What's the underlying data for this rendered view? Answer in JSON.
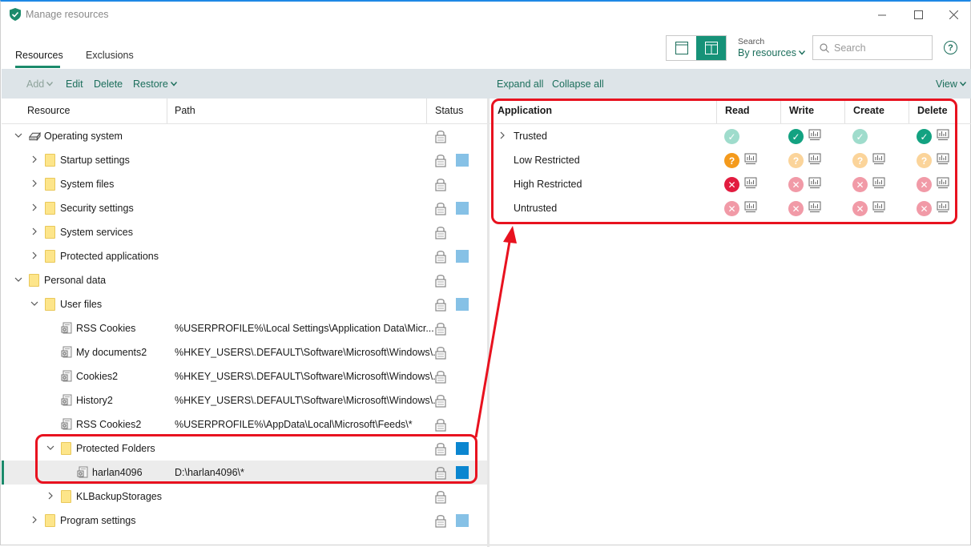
{
  "window": {
    "title": "Manage resources"
  },
  "header": {
    "tabs": [
      {
        "label": "Resources"
      },
      {
        "label": "Exclusions"
      }
    ],
    "search_caption": "Search",
    "search_mode": "By resources",
    "search_placeholder": "Search"
  },
  "toolbar": {
    "add": "Add",
    "edit": "Edit",
    "delete": "Delete",
    "restore": "Restore",
    "expand_all": "Expand all",
    "collapse_all": "Collapse all",
    "view": "View"
  },
  "left_columns": {
    "resource": "Resource",
    "path": "Path",
    "status": "Status"
  },
  "tree": [
    {
      "label": "Operating system",
      "path": "",
      "level": 0,
      "expand": "expanded",
      "icon": "hdd-icon",
      "status": "none"
    },
    {
      "label": "Startup settings",
      "path": "",
      "level": 1,
      "expand": "collapsed",
      "icon": "folder-icon",
      "status": "light"
    },
    {
      "label": "System files",
      "path": "",
      "level": 1,
      "expand": "collapsed",
      "icon": "folder-icon",
      "status": "none"
    },
    {
      "label": "Security settings",
      "path": "",
      "level": 1,
      "expand": "collapsed",
      "icon": "folder-icon",
      "status": "light"
    },
    {
      "label": "System services",
      "path": "",
      "level": 1,
      "expand": "collapsed",
      "icon": "folder-icon",
      "status": "none"
    },
    {
      "label": "Protected applications",
      "path": "",
      "level": 1,
      "expand": "collapsed",
      "icon": "folder-icon",
      "status": "light"
    },
    {
      "label": "Personal data",
      "path": "",
      "level": 0,
      "expand": "expanded",
      "icon": "folder-icon",
      "status": "none"
    },
    {
      "label": "User files",
      "path": "",
      "level": 1,
      "expand": "expanded",
      "icon": "folder-icon",
      "status": "light"
    },
    {
      "label": "RSS Cookies",
      "path": "%USERPROFILE%\\Local Settings\\Application Data\\Micr...",
      "level": 2,
      "expand": "none",
      "icon": "registry-icon",
      "status": "none"
    },
    {
      "label": "My documents2",
      "path": "%HKEY_USERS\\.DEFAULT\\Software\\Microsoft\\Windows\\...",
      "level": 2,
      "expand": "none",
      "icon": "registry-icon",
      "status": "none"
    },
    {
      "label": "Cookies2",
      "path": "%HKEY_USERS\\.DEFAULT\\Software\\Microsoft\\Windows\\...",
      "level": 2,
      "expand": "none",
      "icon": "registry-icon",
      "status": "none"
    },
    {
      "label": "History2",
      "path": "%HKEY_USERS\\.DEFAULT\\Software\\Microsoft\\Windows\\...",
      "level": 2,
      "expand": "none",
      "icon": "registry-icon",
      "status": "none"
    },
    {
      "label": "RSS Cookies2",
      "path": "%USERPROFILE%\\AppData\\Local\\Microsoft\\Feeds\\*",
      "level": 2,
      "expand": "none",
      "icon": "registry-icon",
      "status": "none"
    },
    {
      "label": "Protected Folders",
      "path": "",
      "level": 2,
      "expand": "expanded",
      "icon": "folder-icon",
      "status": "strong"
    },
    {
      "label": "harlan4096",
      "path": "D:\\harlan4096\\*",
      "level": 3,
      "expand": "none",
      "icon": "registry-icon",
      "status": "strong",
      "selected": true
    },
    {
      "label": "KLBackupStorages",
      "path": "",
      "level": 2,
      "expand": "collapsed",
      "icon": "folder-icon",
      "status": "none"
    },
    {
      "label": "Program settings",
      "path": "",
      "level": 1,
      "expand": "collapsed",
      "icon": "folder-icon",
      "status": "light"
    }
  ],
  "right_columns": {
    "application": "Application",
    "read": "Read",
    "write": "Write",
    "create": "Create",
    "delete": "Delete"
  },
  "permissions": [
    {
      "label": "Trusted",
      "expandable": true,
      "cells": [
        {
          "state": "allow-light",
          "log": false
        },
        {
          "state": "allow",
          "log": true
        },
        {
          "state": "allow-light",
          "log": false
        },
        {
          "state": "allow",
          "log": true
        }
      ]
    },
    {
      "label": "Low Restricted",
      "expandable": false,
      "cells": [
        {
          "state": "ask",
          "log": true
        },
        {
          "state": "ask-light",
          "log": true
        },
        {
          "state": "ask-light",
          "log": true
        },
        {
          "state": "ask-light",
          "log": true
        }
      ]
    },
    {
      "label": "High Restricted",
      "expandable": false,
      "cells": [
        {
          "state": "deny",
          "log": true
        },
        {
          "state": "deny-light",
          "log": true
        },
        {
          "state": "deny-light",
          "log": true
        },
        {
          "state": "deny-light",
          "log": true
        }
      ]
    },
    {
      "label": "Untrusted",
      "expandable": false,
      "cells": [
        {
          "state": "deny-light",
          "log": true
        },
        {
          "state": "deny-light",
          "log": true
        },
        {
          "state": "deny-light",
          "log": true
        },
        {
          "state": "deny-light",
          "log": true
        }
      ]
    }
  ],
  "colors": {
    "accent": "#1b8a6b",
    "annotation": "#e8121f",
    "status_light": "#86c1e6",
    "status_strong": "#0b86d0"
  }
}
